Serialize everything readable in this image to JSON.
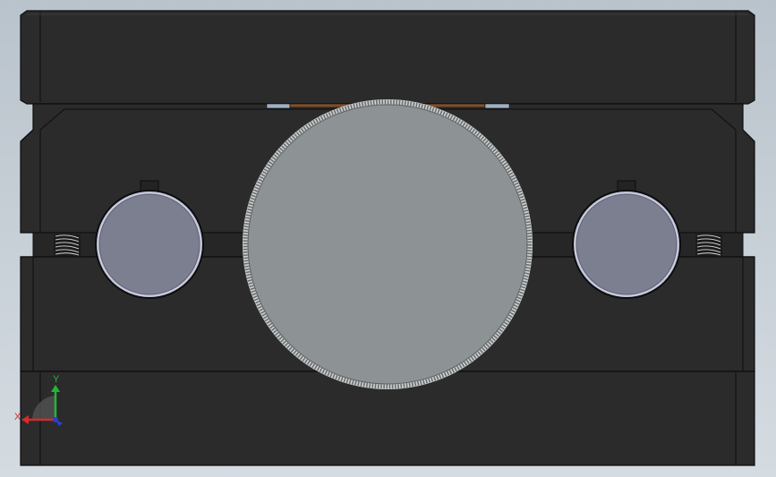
{
  "viewport": {
    "background_top": "#b9c3cb",
    "background_bottom": "#d4dbe1"
  },
  "model": {
    "body_color": "#2b2b2b",
    "edge_color": "#0d0d0d",
    "face_highlight": "#3a3a3a",
    "gear_color": "#8d9294",
    "gear_teeth_color": "#cfd2d3",
    "shaft_color": "#7c7f8f",
    "shaft_rim_color": "#c6c9de",
    "bronze_color": "#7a4f2e",
    "steel_strip_color": "#9fb0c4",
    "spring_color": "#c8c8c8"
  },
  "triad": {
    "x_label": "X",
    "y_label": "Y",
    "x_color": "#d62b2b",
    "y_color": "#23b53a",
    "z_color": "#2b3fd6"
  }
}
